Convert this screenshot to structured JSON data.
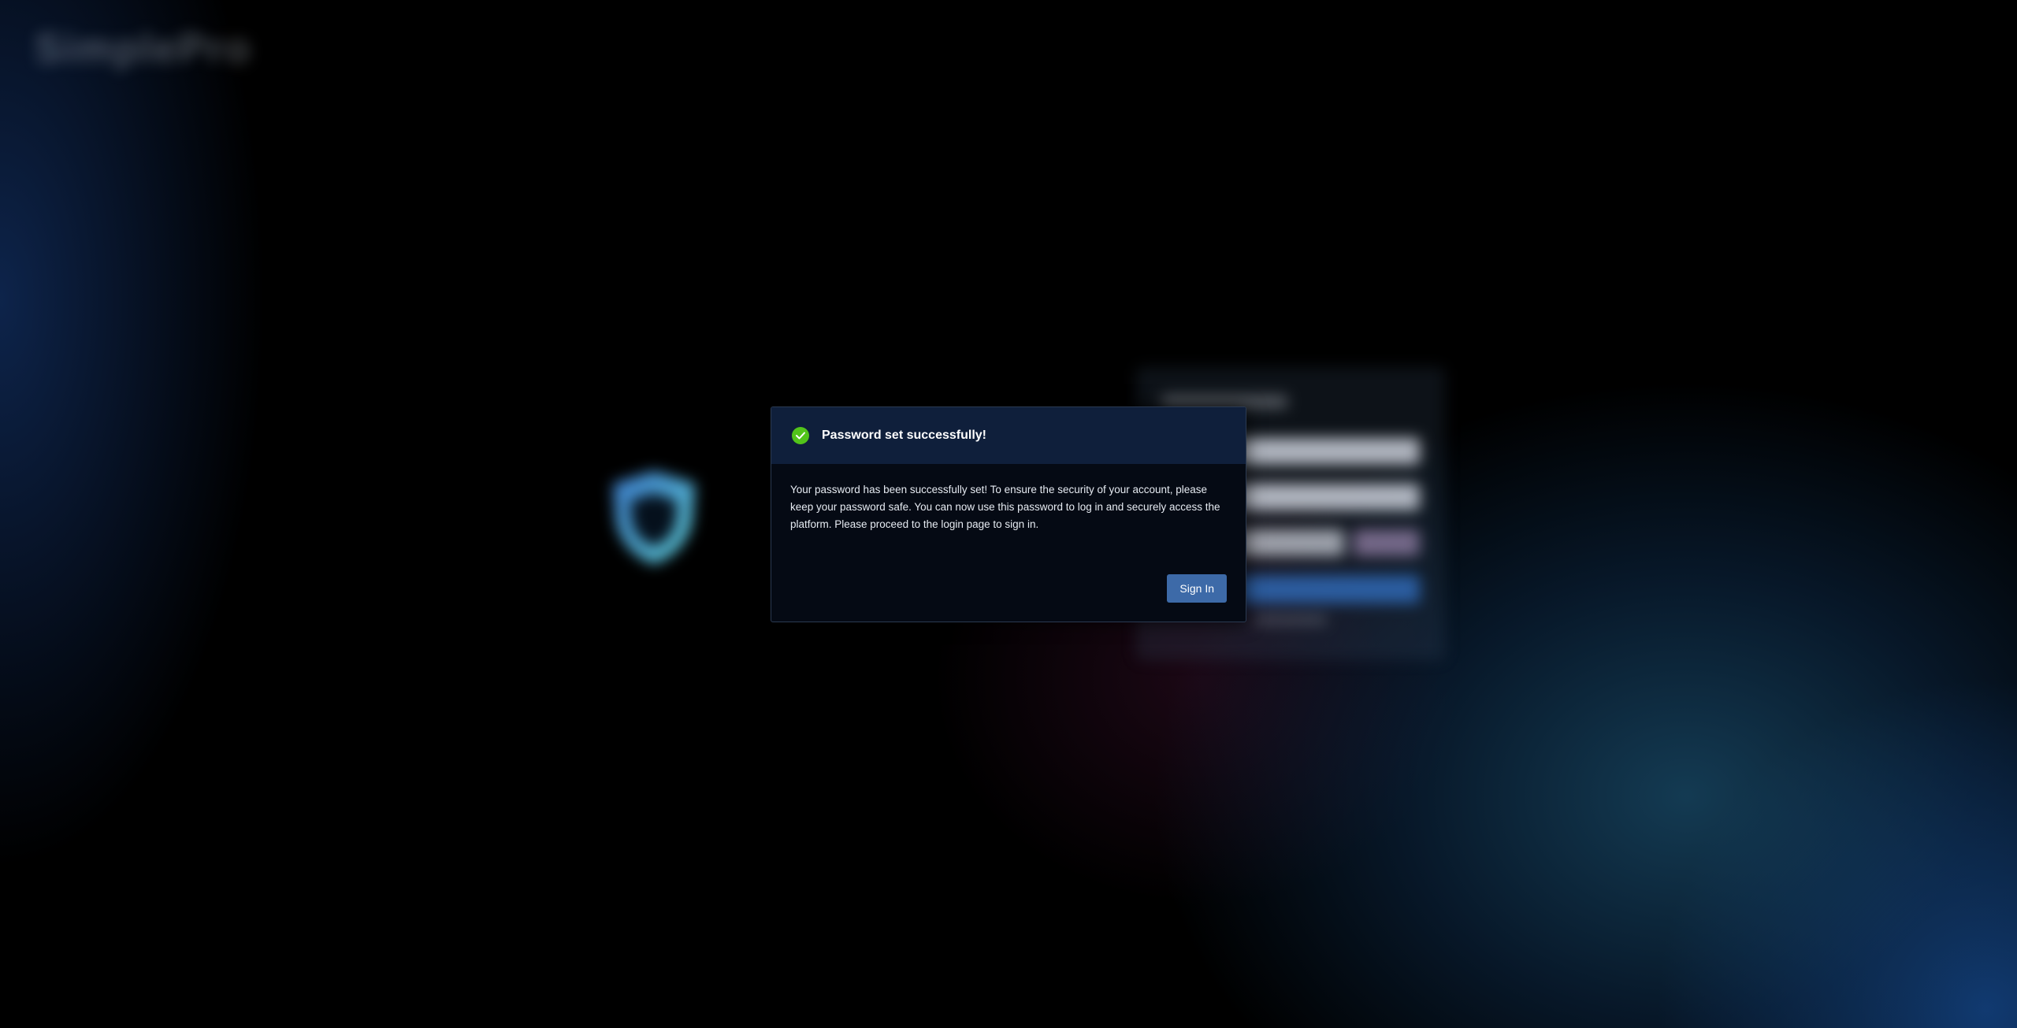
{
  "background": {
    "app_logo_text": "SimplePro",
    "note": ""
  },
  "modal": {
    "title": "Password set successfully!",
    "icon": "check-circle-icon",
    "message": "Your password has been successfully set! To ensure the security of your account, please keep your password safe. You can now use this password to log in and securely access the platform. Please proceed to the login page to sign in.",
    "sign_in_label": "Sign In"
  },
  "colors": {
    "success": "#52c41a",
    "primary_button": "#3d6aa8",
    "modal_header": "#0f1f3b",
    "modal_body": "#050a14"
  }
}
